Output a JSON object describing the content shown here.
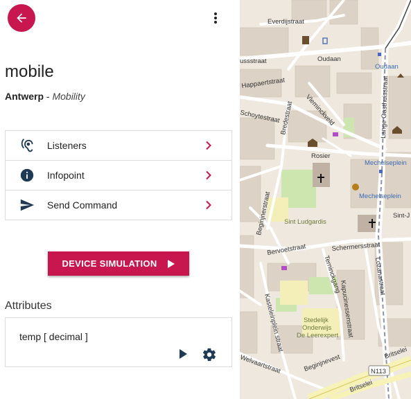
{
  "header": {
    "back_icon": "arrow-left-icon",
    "menu_icon": "more-vert-icon",
    "accent": "#c8164f"
  },
  "device": {
    "name": "mobile",
    "city": "Antwerp",
    "separator": " - ",
    "category": "Mobility"
  },
  "menu": [
    {
      "label": "Listeners",
      "icon": "ear-icon"
    },
    {
      "label": "Infopoint",
      "icon": "info-icon"
    },
    {
      "label": "Send Command",
      "icon": "send-icon"
    }
  ],
  "simulation": {
    "label": "DEVICE SIMULATION"
  },
  "attributes": {
    "heading": "Attributes",
    "items": [
      {
        "label": "temp [ decimal ]"
      }
    ]
  },
  "map": {
    "streets": [
      "Everdijstraat",
      "Oudaan",
      "Oudaan",
      "ussstraat",
      "Happaertstraat",
      "Schoytestraat",
      "Bredestraat",
      "Vleminckveld",
      "Lange Gasthuisstraat",
      "Rosier",
      "Mechelseplein",
      "Mechelseplein",
      "Sint Ludgardis",
      "Beginjnerstraat",
      "Bervoetstraat",
      "Schermersstraat",
      "Sint-J",
      "Lozanastraat",
      "Terninckgang",
      "Kapucinessenstraat",
      "Kasteleinplein straat",
      "Stedelijk",
      "Onderwijs",
      "De Leerexpert",
      "Welvaartstraat",
      "Beginjnevest",
      "N113",
      "Britselei",
      "Britselei"
    ]
  }
}
